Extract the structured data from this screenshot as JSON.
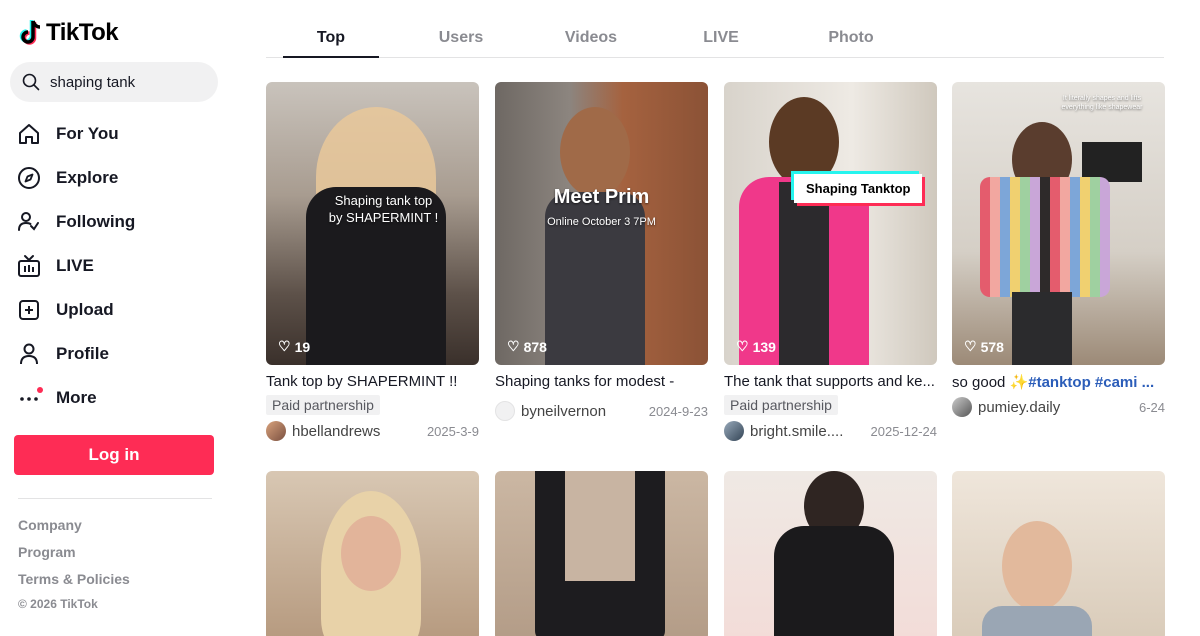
{
  "brand": {
    "name": "TikTok",
    "accent": "#fe2c55"
  },
  "search": {
    "value": "shaping tank"
  },
  "nav": [
    {
      "label": "For You",
      "icon": "home-icon"
    },
    {
      "label": "Explore",
      "icon": "compass-icon"
    },
    {
      "label": "Following",
      "icon": "following-icon"
    },
    {
      "label": "LIVE",
      "icon": "live-icon"
    },
    {
      "label": "Upload",
      "icon": "upload-icon"
    },
    {
      "label": "Profile",
      "icon": "profile-icon"
    },
    {
      "label": "More",
      "icon": "more-icon"
    }
  ],
  "login_label": "Log in",
  "footer": {
    "links": [
      "Company",
      "Program",
      "Terms & Policies"
    ],
    "copyright": "© 2026 TikTok"
  },
  "tabs": [
    "Top",
    "Users",
    "Videos",
    "LIVE",
    "Photo"
  ],
  "active_tab": "Top",
  "videos": [
    {
      "likes": "19",
      "caption": "Tank top by SHAPERMINT !!",
      "tag": "Paid partnership",
      "user": "hbellandrews",
      "date": "2025-3-9",
      "overlay": "Shaping tank top\nby SHAPERMINT !"
    },
    {
      "likes": "878",
      "caption": "Shaping tanks for modest -",
      "tag": "",
      "user": "byneilvernon",
      "date": "2024-9-23",
      "overlay_title": "Meet Prim",
      "overlay_sub": "Online October 3 7PM"
    },
    {
      "likes": "139",
      "caption": "The tank that supports and ke...",
      "tag": "Paid partnership",
      "user": "bright.smile....",
      "date": "2025-12-24",
      "overlay": "Shaping Tanktop"
    },
    {
      "likes": "578",
      "caption_prefix": "so good ✨",
      "caption_tags": "#tanktop #cami ...",
      "tag": "",
      "user": "pumiey.daily",
      "date": "6-24",
      "overlay": "It literally shapes and lifts everything like shapewear"
    }
  ]
}
